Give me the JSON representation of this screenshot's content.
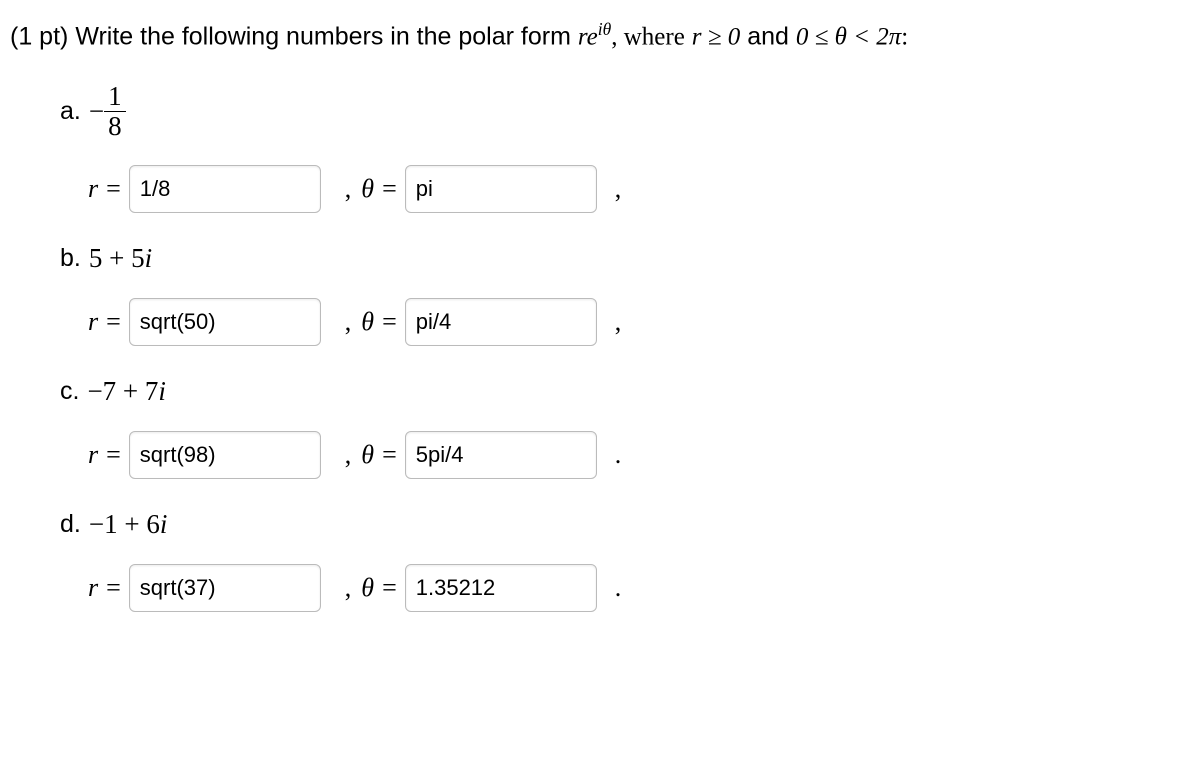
{
  "prompt": {
    "pts": "(1 pt)",
    "text_before": "Write the following numbers in the polar form",
    "form_r": "r",
    "form_e": "e",
    "form_exp": "iθ",
    "text_mid": ", where",
    "cond_r": "r ≥ 0",
    "cond_and": "and",
    "cond_theta": "0 ≤ θ < 2π",
    "colon": ":"
  },
  "labels": {
    "r": "r",
    "eq": "=",
    "theta": "θ",
    "comma_sep": ",",
    "period": "."
  },
  "parts": {
    "a": {
      "letter": "a.",
      "expr_prefix": "−",
      "frac_num": "1",
      "frac_den": "8",
      "r_value": "1/8",
      "theta_value": "pi",
      "trail": ","
    },
    "b": {
      "letter": "b.",
      "expr": "5 + 5i",
      "r_value": "sqrt(50)",
      "theta_value": "pi/4",
      "trail": ","
    },
    "c": {
      "letter": "c.",
      "expr": "−7 + 7i",
      "r_value": "sqrt(98)",
      "theta_value": "5pi/4",
      "trail": "."
    },
    "d": {
      "letter": "d.",
      "expr": "−1 + 6i",
      "r_value": "sqrt(37)",
      "theta_value": "1.35212",
      "trail": "."
    }
  }
}
